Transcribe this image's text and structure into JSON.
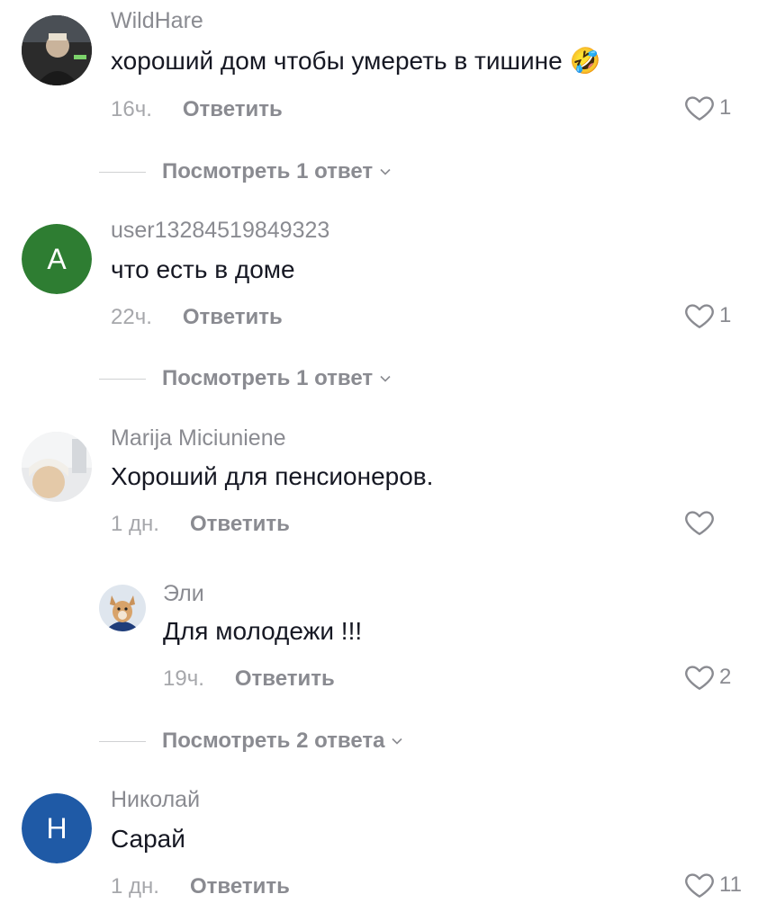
{
  "comments": [
    {
      "username": "WildHare",
      "text": "хороший дом чтобы умереть в тишине",
      "emoji": "🤣",
      "time": "16ч.",
      "reply_label": "Ответить",
      "likes": "1",
      "avatar_icon": "photo-avatar",
      "view_replies": "Посмотреть 1 ответ"
    },
    {
      "username": "user13284519849323",
      "text": "что есть в доме",
      "time": "22ч.",
      "reply_label": "Ответить",
      "likes": "1",
      "avatar_letter": "A",
      "avatar_color": "#2e7d32",
      "view_replies": "Посмотреть 1 ответ"
    },
    {
      "username": "Marija Miciuniene",
      "text": "Хороший для пенсионеров.",
      "time": "1 дн.",
      "reply_label": "Ответить",
      "likes": "",
      "avatar_icon": "photo-avatar",
      "replies": [
        {
          "username": "Эли",
          "text": "Для молодежи !!!",
          "time": "19ч.",
          "reply_label": "Ответить",
          "likes": "2",
          "avatar_icon": "dog-photo-avatar"
        }
      ],
      "view_replies": "Посмотреть 2 ответа"
    },
    {
      "username": "Николай",
      "text": "Сарай",
      "time": "1 дн.",
      "reply_label": "Ответить",
      "likes": "11",
      "avatar_letter": "Н",
      "avatar_color": "#1f5aa6"
    }
  ]
}
